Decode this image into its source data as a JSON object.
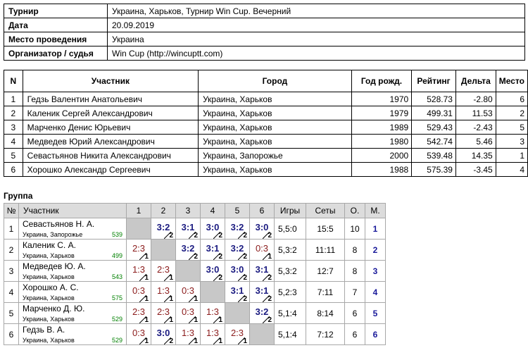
{
  "info": {
    "rows": [
      {
        "k": "Турнир",
        "v": "Украина, Харьков, Турнир Win Cup. Вечерний"
      },
      {
        "k": "Дата",
        "v": "20.09.2019"
      },
      {
        "k": "Место проведения",
        "v": "Украина"
      },
      {
        "k": "Организатор / судья",
        "v": "Win Cup (http://wincuptt.com)"
      }
    ]
  },
  "participants": {
    "headers": [
      "N",
      "Участник",
      "Город",
      "Год рожд.",
      "Рейтинг",
      "Дельта",
      "Место"
    ],
    "rows": [
      [
        "1",
        "Гедзь Валентин Анатольевич",
        "Украина, Харьков",
        "1970",
        "528.73",
        "-2.80",
        "6"
      ],
      [
        "2",
        "Каленик Сергей Александрович",
        "Украина, Харьков",
        "1979",
        "499.31",
        "11.53",
        "2"
      ],
      [
        "3",
        "Марченко Денис Юрьевич",
        "Украина, Харьков",
        "1989",
        "529.43",
        "-2.43",
        "5"
      ],
      [
        "4",
        "Медведев Юрий Александрович",
        "Украина, Харьков",
        "1980",
        "542.74",
        "5.46",
        "3"
      ],
      [
        "5",
        "Севастьянов Никита Александрович",
        "Украина, Запорожье",
        "2000",
        "539.48",
        "14.35",
        "1"
      ],
      [
        "6",
        "Хорошко Александр Сергеевич",
        "Украина, Харьков",
        "1988",
        "575.39",
        "-3.45",
        "4"
      ]
    ]
  },
  "group": {
    "title": "Группа",
    "headers": {
      "no": "№",
      "participant": "Участник",
      "cols": [
        "1",
        "2",
        "3",
        "4",
        "5",
        "6"
      ],
      "games": "Игры",
      "sets": "Сеты",
      "points": "О.",
      "place": "М."
    },
    "rows": [
      {
        "no": "1",
        "name": "Севастьянов Н. А.",
        "city": "Украина, Запорожье",
        "rating": "539",
        "cells": [
          null,
          {
            "s": "3:2",
            "p": "2",
            "w": true
          },
          {
            "s": "3:1",
            "p": "2",
            "w": true
          },
          {
            "s": "3:0",
            "p": "2",
            "w": true
          },
          {
            "s": "3:2",
            "p": "2",
            "w": true
          },
          {
            "s": "3:0",
            "p": "2",
            "w": true
          }
        ],
        "games": "5,5:0",
        "sets": "15:5",
        "points": "10",
        "place": "1"
      },
      {
        "no": "2",
        "name": "Каленик С. А.",
        "city": "Украина, Харьков",
        "rating": "499",
        "cells": [
          {
            "s": "2:3",
            "p": "1",
            "w": false
          },
          null,
          {
            "s": "3:2",
            "p": "2",
            "w": true
          },
          {
            "s": "3:1",
            "p": "2",
            "w": true
          },
          {
            "s": "3:2",
            "p": "2",
            "w": true
          },
          {
            "s": "0:3",
            "p": "1",
            "w": false
          }
        ],
        "games": "5,3:2",
        "sets": "11:11",
        "points": "8",
        "place": "2"
      },
      {
        "no": "3",
        "name": "Медведев Ю. А.",
        "city": "Украина, Харьков",
        "rating": "543",
        "cells": [
          {
            "s": "1:3",
            "p": "1",
            "w": false
          },
          {
            "s": "2:3",
            "p": "1",
            "w": false
          },
          null,
          {
            "s": "3:0",
            "p": "2",
            "w": true
          },
          {
            "s": "3:0",
            "p": "2",
            "w": true
          },
          {
            "s": "3:1",
            "p": "2",
            "w": true
          }
        ],
        "games": "5,3:2",
        "sets": "12:7",
        "points": "8",
        "place": "3"
      },
      {
        "no": "4",
        "name": "Хорошко А. С.",
        "city": "Украина, Харьков",
        "rating": "575",
        "cells": [
          {
            "s": "0:3",
            "p": "1",
            "w": false
          },
          {
            "s": "1:3",
            "p": "1",
            "w": false
          },
          {
            "s": "0:3",
            "p": "1",
            "w": false
          },
          null,
          {
            "s": "3:1",
            "p": "2",
            "w": true
          },
          {
            "s": "3:1",
            "p": "2",
            "w": true
          }
        ],
        "games": "5,2:3",
        "sets": "7:11",
        "points": "7",
        "place": "4"
      },
      {
        "no": "5",
        "name": "Марченко Д. Ю.",
        "city": "Украина, Харьков",
        "rating": "529",
        "cells": [
          {
            "s": "2:3",
            "p": "1",
            "w": false
          },
          {
            "s": "2:3",
            "p": "1",
            "w": false
          },
          {
            "s": "0:3",
            "p": "1",
            "w": false
          },
          {
            "s": "1:3",
            "p": "1",
            "w": false
          },
          null,
          {
            "s": "3:2",
            "p": "2",
            "w": true
          }
        ],
        "games": "5,1:4",
        "sets": "8:14",
        "points": "6",
        "place": "5"
      },
      {
        "no": "6",
        "name": "Гедзь В. А.",
        "city": "Украина, Харьков",
        "rating": "529",
        "cells": [
          {
            "s": "0:3",
            "p": "1",
            "w": false
          },
          {
            "s": "3:0",
            "p": "2",
            "w": true
          },
          {
            "s": "1:3",
            "p": "1",
            "w": false
          },
          {
            "s": "1:3",
            "p": "1",
            "w": false
          },
          {
            "s": "2:3",
            "p": "1",
            "w": false
          },
          null
        ],
        "games": "5,1:4",
        "sets": "7:12",
        "points": "6",
        "place": "6"
      }
    ]
  },
  "colors": {
    "win": "#1a1a80",
    "loss": "#8a1a1a",
    "rating": "#008000",
    "diag": "#c8c8c8",
    "header": "#dcdcdc"
  }
}
